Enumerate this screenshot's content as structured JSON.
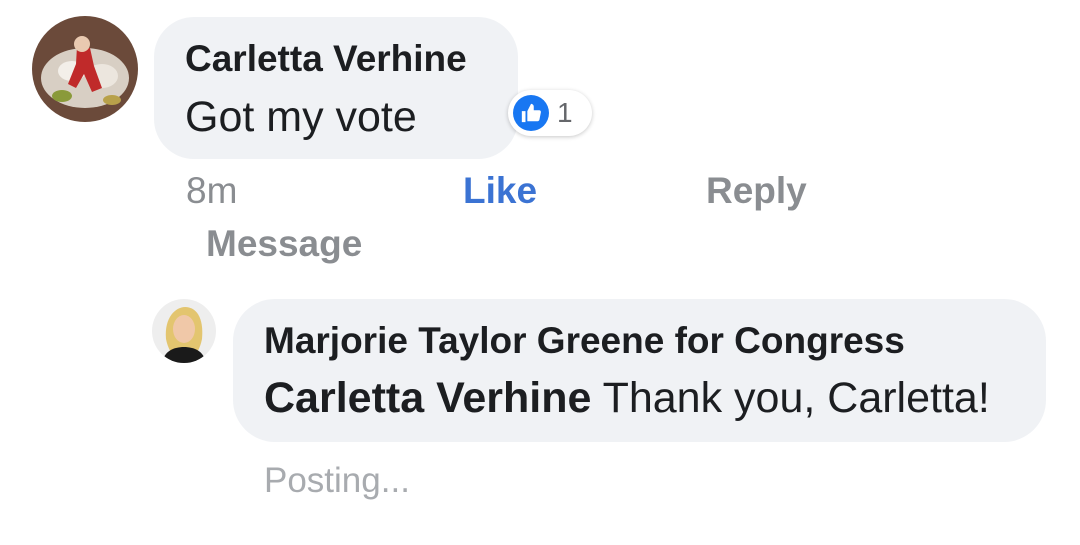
{
  "comment": {
    "author": "Carletta Verhine",
    "text": "Got my vote",
    "reaction_count": "1",
    "time": "8m",
    "actions": {
      "like": "Like",
      "reply": "Reply",
      "message": "Message"
    }
  },
  "reply": {
    "author": "Marjorie Taylor Greene for Congress",
    "mention": "Carletta Verhine",
    "text": " Thank you, Carletta!",
    "status": "Posting..."
  },
  "colors": {
    "bubble": "#f0f2f5",
    "like_blue": "#1877f2",
    "action_grey": "#8a8d91",
    "text_dark": "#1c1e21"
  }
}
